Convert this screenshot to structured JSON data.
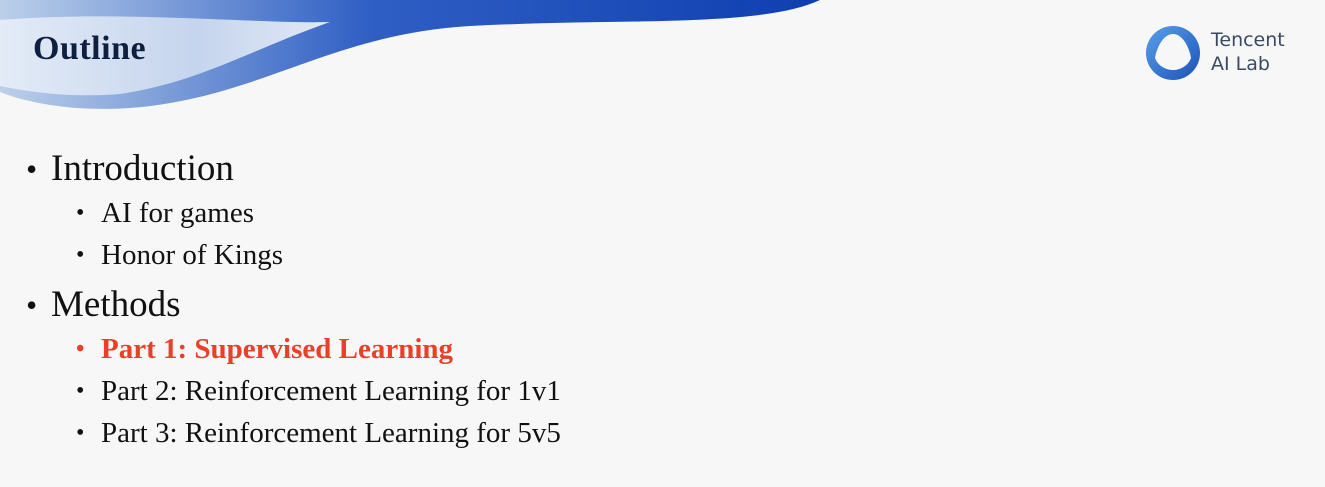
{
  "slide": {
    "title": "Outline",
    "logo": {
      "line1": "Tencent",
      "line2": "AI Lab"
    },
    "accent_color": "#e8402a",
    "outline": [
      {
        "label": "Introduction",
        "items": [
          {
            "label": "AI for games",
            "active": false
          },
          {
            "label": "Honor of Kings",
            "active": false
          }
        ]
      },
      {
        "label": "Methods",
        "items": [
          {
            "label": "Part 1: Supervised Learning",
            "active": true
          },
          {
            "label": "Part 2: Reinforcement Learning for 1v1",
            "active": false
          },
          {
            "label": "Part 3: Reinforcement Learning for 5v5",
            "active": false
          }
        ]
      }
    ]
  }
}
